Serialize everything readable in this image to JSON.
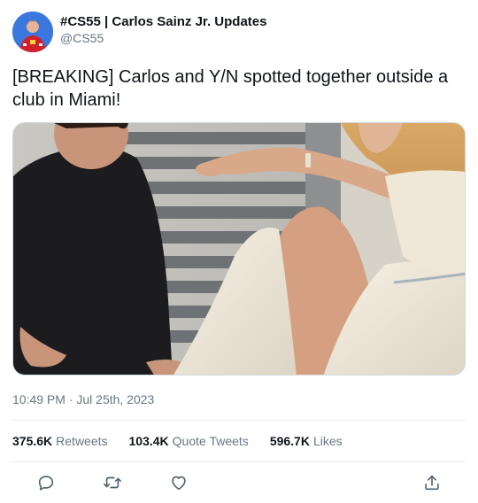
{
  "author": {
    "display_name": "#CS55 | Carlos Sainz Jr. Updates",
    "handle": "@CS55",
    "avatar_icon": "profile-avatar"
  },
  "tweet": {
    "text": "[BREAKING] Carlos and Y/N spotted together outside a club in Miami!",
    "timestamp": "10:49 PM · Jul 25th, 2023"
  },
  "stats": [
    {
      "count": "375.6K",
      "label": "Retweets"
    },
    {
      "count": "103.4K",
      "label": "Quote Tweets"
    },
    {
      "count": "596.7K",
      "label": "Likes"
    }
  ],
  "actions": [
    "reply-icon",
    "retweet-icon",
    "like-icon",
    "share-icon"
  ],
  "colors": {
    "text": "#0f1419",
    "secondary": "#687684",
    "divider": "#e6ecf0",
    "action_icon": "#536471"
  }
}
